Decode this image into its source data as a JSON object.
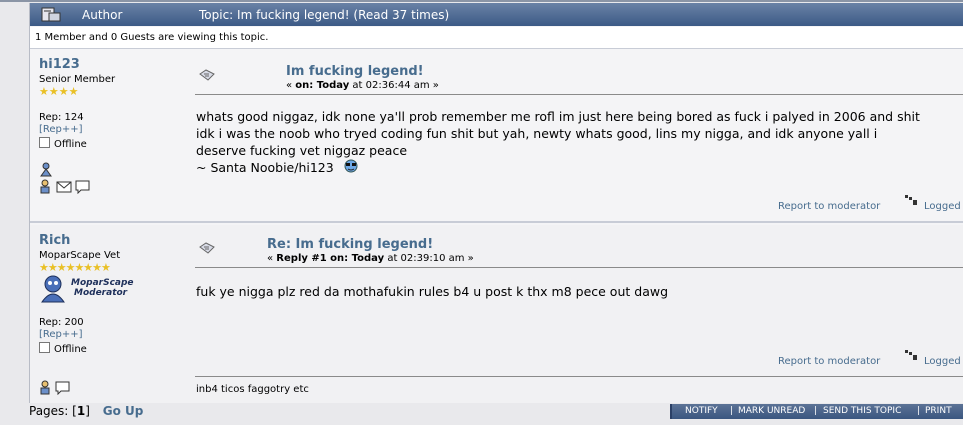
{
  "header": {
    "author_label": "Author",
    "topic_text": "Topic: Im fucking legend!  (Read 37 times)"
  },
  "viewing_text": "1 Member and 0 Guests are viewing this topic.",
  "posts": [
    {
      "username": "hi123",
      "user_title": "Senior Member",
      "stars": "★★★★",
      "rep": "Rep: 124",
      "rep_link": "[Rep++]",
      "status": "Offline",
      "title": "Im fucking legend!",
      "meta_prefix": "« ",
      "meta_on": "on: Today",
      "meta_time": " at 02:36:44 am »",
      "body_line1": "whats good niggaz, idk none ya'll prob remember me rofl im just here being bored as fuck i palyed in 2006 and shit",
      "body_line2": "idk i was the noob who tryed coding fun shit but yah, newty whats good, lins my nigga, and idk anyone yall i",
      "body_line3": "deserve fucking vet niggaz peace",
      "body_line4": "~ Santa Noobie/hi123",
      "report": "Report to moderator",
      "logged": "Logged"
    },
    {
      "username": "Rich",
      "user_title": "MoparScape Vet",
      "stars": "★★★★★★★★",
      "badge_line1": "MoparScape",
      "badge_line2": "Moderator",
      "rep": "Rep: 200",
      "rep_link": "[Rep++]",
      "status": "Offline",
      "title": "Re: Im fucking legend!",
      "meta_prefix": "« ",
      "meta_on": "Reply #1 on: Today",
      "meta_time": " at 02:39:10 am »",
      "body_line1": "fuk ye nigga plz red da mothafukin rules b4 u post k thx m8 pece out dawg",
      "report": "Report to moderator",
      "logged": "Logged",
      "signature": "inb4 ticos faggotry etc"
    }
  ],
  "footer": {
    "pages_label": "Pages: [",
    "current_page": "1",
    "pages_close": "]",
    "go_up": "Go Up",
    "buttons": [
      "NOTIFY",
      "MARK UNREAD",
      "SEND THIS TOPIC",
      "PRINT"
    ],
    "divider": "|"
  },
  "colors": {
    "link": "#476c8e",
    "header_gradient_top": "#6a82a6",
    "header_gradient_bottom": "#3c5a86",
    "stars": "#e9c026"
  }
}
